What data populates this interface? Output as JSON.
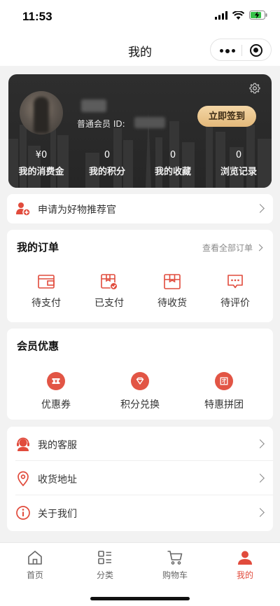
{
  "status_bar": {
    "time": "11:53"
  },
  "nav": {
    "title": "我的"
  },
  "profile": {
    "member_label": "普通会员 ID:",
    "signin_label": "立即签到",
    "stats": [
      {
        "value": "¥0",
        "label": "我的消费金"
      },
      {
        "value": "0",
        "label": "我的积分"
      },
      {
        "value": "0",
        "label": "我的收藏"
      },
      {
        "value": "0",
        "label": "浏览记录"
      }
    ]
  },
  "recommend": {
    "label": "申请为好物推荐官"
  },
  "orders": {
    "title": "我的订单",
    "view_all": "查看全部订单",
    "items": [
      {
        "label": "待支付",
        "icon": "wallet-icon"
      },
      {
        "label": "已支付",
        "icon": "paid-box-icon"
      },
      {
        "label": "待收货",
        "icon": "package-icon"
      },
      {
        "label": "待评价",
        "icon": "comment-icon"
      }
    ]
  },
  "benefits": {
    "title": "会员优惠",
    "items": [
      {
        "label": "优惠券",
        "icon": "ticket-icon"
      },
      {
        "label": "积分兑换",
        "icon": "diamond-icon"
      },
      {
        "label": "特惠拼团",
        "icon": "group-icon"
      }
    ]
  },
  "service": {
    "items": [
      {
        "label": "我的客服",
        "icon": "headset-icon"
      },
      {
        "label": "收货地址",
        "icon": "location-pin-icon"
      },
      {
        "label": "关于我们",
        "icon": "info-icon"
      }
    ]
  },
  "tabbar": {
    "items": [
      {
        "label": "首页",
        "icon": "home-icon"
      },
      {
        "label": "分类",
        "icon": "category-icon"
      },
      {
        "label": "购物车",
        "icon": "cart-icon"
      },
      {
        "label": "我的",
        "icon": "user-icon",
        "active": true
      }
    ]
  },
  "colors": {
    "accent": "#e14b3c",
    "gold": "#e3b87a",
    "card_dark": "#2b2b2b"
  }
}
